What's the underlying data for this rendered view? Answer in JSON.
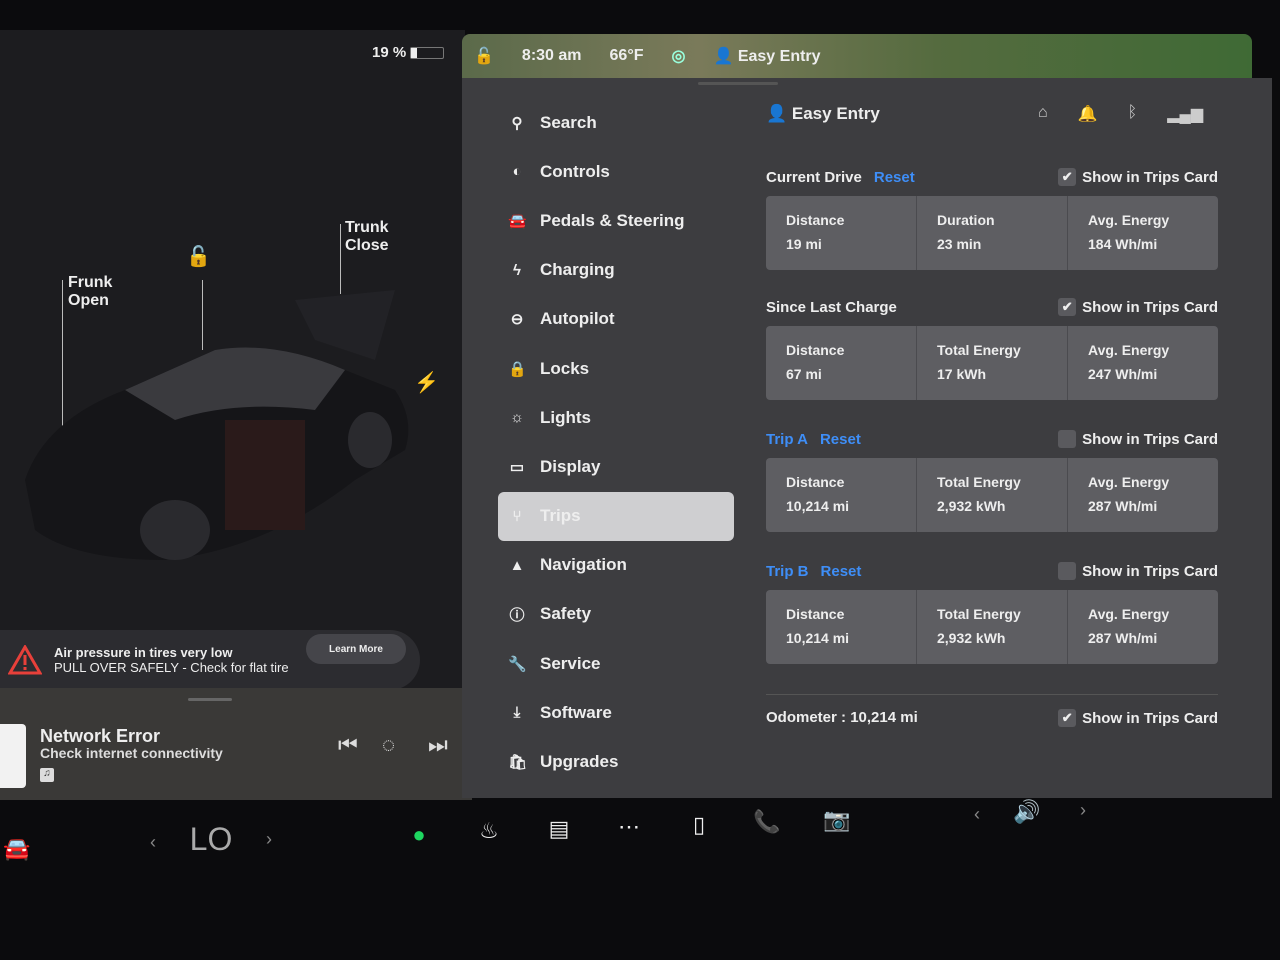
{
  "status": {
    "battery": "19 %",
    "battery_level": 0.19,
    "time": "8:30 am",
    "temp": "66°F",
    "profile": "Easy Entry"
  },
  "car": {
    "frunk": "Frunk\nOpen",
    "trunk": "Trunk\nClose"
  },
  "alert": {
    "title": "Air pressure in tires very low",
    "message": "PULL OVER SAFELY - Check for flat tire",
    "button": "Learn More",
    "color": "#e8403a"
  },
  "media": {
    "title": "Network Error",
    "subtitle": "Check internet connectivity"
  },
  "nav": [
    {
      "label": "Search",
      "icon": "search"
    },
    {
      "label": "Controls",
      "icon": "toggle"
    },
    {
      "label": "Pedals & Steering",
      "icon": "car"
    },
    {
      "label": "Charging",
      "icon": "bolt"
    },
    {
      "label": "Autopilot",
      "icon": "steering"
    },
    {
      "label": "Locks",
      "icon": "lock"
    },
    {
      "label": "Lights",
      "icon": "sun"
    },
    {
      "label": "Display",
      "icon": "display"
    },
    {
      "label": "Trips",
      "icon": "trips",
      "selected": true
    },
    {
      "label": "Navigation",
      "icon": "arrow"
    },
    {
      "label": "Safety",
      "icon": "alert-circle"
    },
    {
      "label": "Service",
      "icon": "wrench"
    },
    {
      "label": "Software",
      "icon": "download"
    },
    {
      "label": "Upgrades",
      "icon": "bag"
    }
  ],
  "trips": {
    "profile": "Easy Entry",
    "show_label": "Show in Trips Card",
    "reset": "Reset",
    "sections": [
      {
        "title": "Current Drive",
        "reset": true,
        "checked": true,
        "cells": [
          [
            "Distance",
            "19 mi"
          ],
          [
            "Duration",
            "23 min"
          ],
          [
            "Avg. Energy",
            "184 Wh/mi"
          ]
        ]
      },
      {
        "title": "Since Last Charge",
        "reset": false,
        "checked": true,
        "cells": [
          [
            "Distance",
            "67 mi"
          ],
          [
            "Total Energy",
            "17 kWh"
          ],
          [
            "Avg. Energy",
            "247 Wh/mi"
          ]
        ]
      },
      {
        "title": "Trip A",
        "reset": true,
        "checked": false,
        "cells": [
          [
            "Distance",
            "10,214 mi"
          ],
          [
            "Total Energy",
            "2,932 kWh"
          ],
          [
            "Avg. Energy",
            "287 Wh/mi"
          ]
        ]
      },
      {
        "title": "Trip B",
        "reset": true,
        "checked": false,
        "cells": [
          [
            "Distance",
            "10,214 mi"
          ],
          [
            "Total Energy",
            "2,932 kWh"
          ],
          [
            "Avg. Energy",
            "287 Wh/mi"
          ]
        ]
      }
    ],
    "odometer_label": "Odometer  :",
    "odometer": "10,214 mi",
    "odometer_checked": true
  },
  "taskbar": {
    "climate": "LO",
    "accent": "#3e8ef7"
  }
}
